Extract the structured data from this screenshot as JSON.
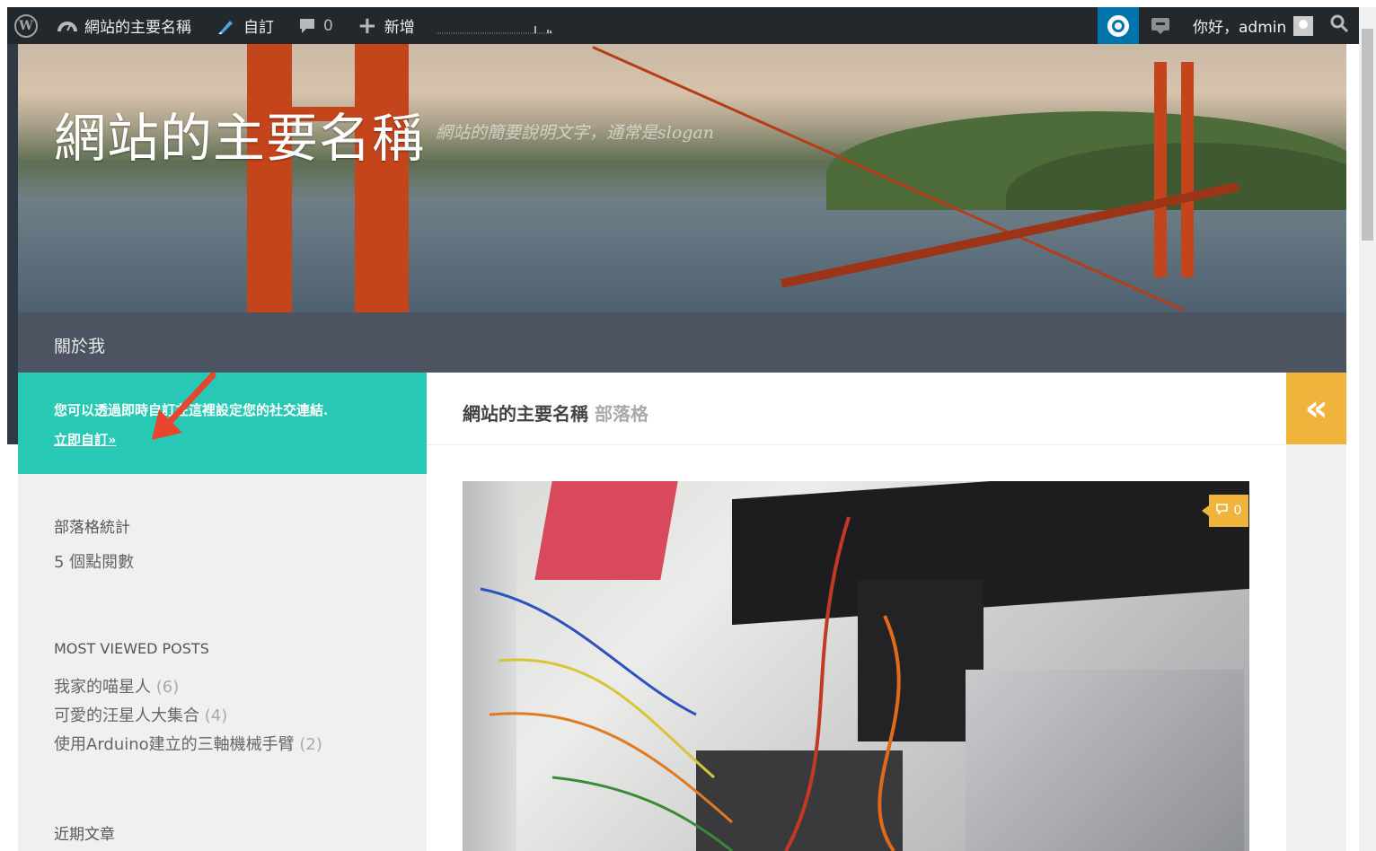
{
  "adminbar": {
    "site_name": "網站的主要名稱",
    "customize": "自訂",
    "comments_count": "0",
    "new_label": "新增",
    "greeting": "你好，admin"
  },
  "header": {
    "site_title": "網站的主要名稱",
    "site_description": "網站的簡要說明文字，通常是slogan"
  },
  "nav": {
    "items": [
      {
        "label": "關於我"
      }
    ]
  },
  "sidebar": {
    "social": {
      "message": "您可以透過即時自訂在這裡設定您的社交連結.",
      "link": "立即自訂»"
    },
    "stats": {
      "title": "部落格統計",
      "value": "5 個點閱數"
    },
    "most_viewed": {
      "title": "MOST VIEWED POSTS",
      "posts": [
        {
          "title": "我家的喵星人",
          "count": "(6)"
        },
        {
          "title": "可愛的汪星人大集合",
          "count": "(4)"
        },
        {
          "title": "使用Arduino建立的三軸機械手臂",
          "count": "(2)"
        }
      ]
    },
    "recent": {
      "title": "近期文章"
    }
  },
  "main": {
    "blog_title": "網站的主要名稱",
    "blog_subtitle": "部落格",
    "toggle_icon": "«",
    "comment_badge": "0"
  },
  "colors": {
    "adminbar": "#23282d",
    "nav": "#4c5461",
    "accent_teal": "#27c9b5",
    "accent_yellow": "#f0b33b"
  }
}
